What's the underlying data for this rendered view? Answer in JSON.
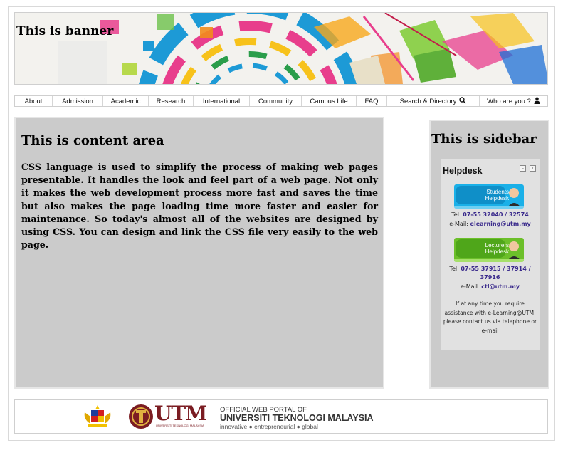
{
  "banner": {
    "title": "This is banner"
  },
  "nav": {
    "items": [
      "About",
      "Admission",
      "Academic",
      "Research",
      "International",
      "Community",
      "Campus Life",
      "FAQ"
    ],
    "search_label": "Search & Directory",
    "user_label": "Who are you ?"
  },
  "content": {
    "title": "This is content area",
    "body": "CSS language is used to simplify the process of making web pages presentable. It handles the look and feel part of a web page. Not only it makes the web development process more fast and saves the time but also makes the page loading time more faster and easier for maintenance. So today's almost all of the websites are designed by using CSS. You can design and link the CSS file very easily to the web page."
  },
  "sidebar": {
    "title": "This is sidebar",
    "helpdesk": {
      "title": "Helpdesk",
      "students_banner": "Students Helpdesk",
      "lecturers_banner": "Lecturers Helpdesk",
      "tel_label": "Tel:",
      "email_label": "e-Mail:",
      "students_tel": "07-55 32040 / 32574",
      "students_email": "elearning@utm.my",
      "lecturers_tel_line1": "07-55 37915 / 37914 /",
      "lecturers_tel_line2": "37916",
      "lecturers_email": "ctl@utm.my",
      "note": "If at any time you require assistance with e-Learning@UTM, please contact us via telephone or e-mail"
    }
  },
  "footer": {
    "logo_text": "UTM",
    "logo_sub": "UNIVERSITI TEKNOLOGI MALAYSIA",
    "portal_line1": "OFFICIAL WEB PORTAL OF",
    "portal_line2": "UNIVERSITI TEKNOLOGI MALAYSIA",
    "portal_line3": "innovative ● entrepreneurial ● global"
  },
  "colors": {
    "panel": "#cbcbcb",
    "helpdesk_bg": "#e1e1e1",
    "link": "#3a2a8c",
    "utm_red": "#7b1c22"
  }
}
